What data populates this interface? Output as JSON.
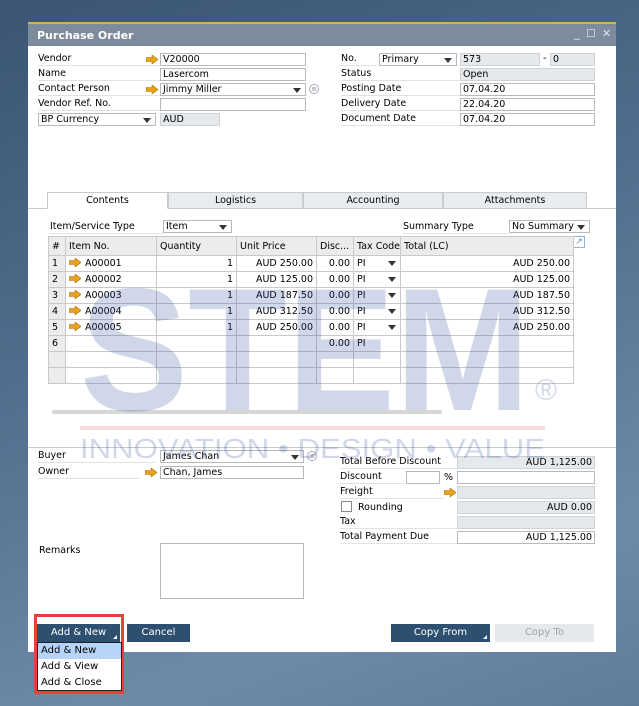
{
  "window": {
    "title": "Purchase Order",
    "controls": [
      "minimize",
      "maximize",
      "close"
    ]
  },
  "header": {
    "vendor": {
      "label": "Vendor",
      "value": "V20000"
    },
    "name": {
      "label": "Name",
      "value": "Lasercom"
    },
    "contact_person": {
      "label": "Contact Person",
      "value": "Jimmy Miller"
    },
    "vendor_ref": {
      "label": "Vendor Ref. No.",
      "value": ""
    },
    "currency": {
      "label": "BP Currency",
      "value": "AUD"
    },
    "no": {
      "label": "No.",
      "series": "Primary",
      "value": "573",
      "sep": "-",
      "suffix": "0"
    },
    "status": {
      "label": "Status",
      "value": "Open"
    },
    "posting_date": {
      "label": "Posting Date",
      "value": "07.04.20"
    },
    "delivery_date": {
      "label": "Delivery Date",
      "value": "22.04.20"
    },
    "document_date": {
      "label": "Document Date",
      "value": "07.04.20"
    }
  },
  "tabs": [
    {
      "label": "Contents",
      "active": true
    },
    {
      "label": "Logistics"
    },
    {
      "label": "Accounting"
    },
    {
      "label": "Attachments"
    }
  ],
  "contents": {
    "item_type_label": "Item/Service Type",
    "item_type": "Item",
    "summary_type_label": "Summary Type",
    "summary_type": "No Summary",
    "columns": [
      "#",
      "Item No.",
      "Quantity",
      "Unit Price",
      "Disc...",
      "Tax Code",
      "Total (LC)"
    ],
    "rows": [
      {
        "n": "1",
        "item": "A00001",
        "qty": "1",
        "price": "AUD 250.00",
        "disc": "0.00",
        "tax": "PI",
        "total": "AUD 250.00"
      },
      {
        "n": "2",
        "item": "A00002",
        "qty": "1",
        "price": "AUD 125.00",
        "disc": "0.00",
        "tax": "PI",
        "total": "AUD 125.00"
      },
      {
        "n": "3",
        "item": "A00003",
        "qty": "1",
        "price": "AUD 187.50",
        "disc": "0.00",
        "tax": "PI",
        "total": "AUD 187.50"
      },
      {
        "n": "4",
        "item": "A00004",
        "qty": "1",
        "price": "AUD 312.50",
        "disc": "0.00",
        "tax": "PI",
        "total": "AUD 312.50"
      },
      {
        "n": "5",
        "item": "A00005",
        "qty": "1",
        "price": "AUD 250.00",
        "disc": "0.00",
        "tax": "PI",
        "total": "AUD 250.00"
      },
      {
        "n": "6",
        "item": "",
        "qty": "",
        "price": "",
        "disc": "0.00",
        "tax": "PI",
        "total": ""
      },
      {
        "n": "",
        "item": "",
        "qty": "",
        "price": "",
        "disc": "",
        "tax": "",
        "total": ""
      },
      {
        "n": "",
        "item": "",
        "qty": "",
        "price": "",
        "disc": "",
        "tax": "",
        "total": ""
      }
    ]
  },
  "footer": {
    "buyer": {
      "label": "Buyer",
      "value": "James Chan"
    },
    "owner": {
      "label": "Owner",
      "value": "Chan, James"
    },
    "remarks": {
      "label": "Remarks",
      "value": ""
    },
    "total_before_discount": {
      "label": "Total Before Discount",
      "value": "AUD 1,125.00"
    },
    "discount": {
      "label": "Discount",
      "percent": "",
      "pct_sign": "%",
      "value": ""
    },
    "freight": {
      "label": "Freight",
      "value": ""
    },
    "rounding": {
      "label": "Rounding",
      "checked": false,
      "value": "AUD 0.00"
    },
    "tax": {
      "label": "Tax",
      "value": ""
    },
    "total_payment_due": {
      "label": "Total Payment Due",
      "value": "AUD 1,125.00"
    }
  },
  "buttons": {
    "add_new": "Add & New",
    "cancel": "Cancel",
    "copy_from": "Copy From",
    "copy_to": "Copy To"
  },
  "add_menu": {
    "items": [
      "Add & New",
      "Add & View",
      "Add & Close"
    ],
    "highlighted": 0
  },
  "watermark": {
    "text": "STEM",
    "tagline": "INNOVATION • DESIGN • VALUE"
  },
  "colors": {
    "title_bar": "#7d8c9c",
    "button": "#2e5070",
    "highlight": "#b5d4f7",
    "callout": "#e8413c",
    "arrow": "#e8a317"
  }
}
